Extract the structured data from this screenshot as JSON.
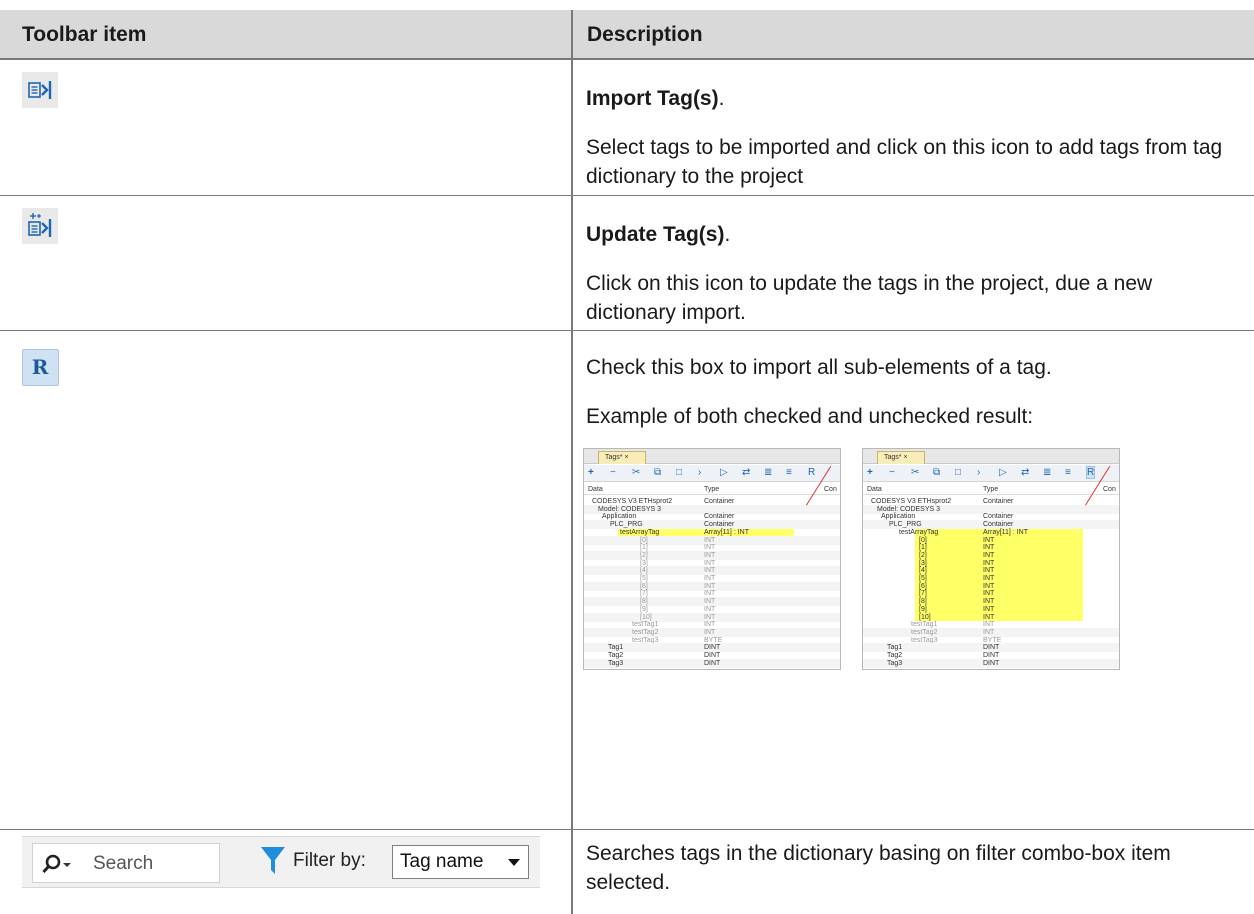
{
  "header": {
    "col1": "Toolbar item",
    "col2": "Description"
  },
  "rows": [
    {
      "icon": "import-tags-icon",
      "title": "Import Tag(s)",
      "title_suffix": ".",
      "desc": "Select tags to be imported and click on this icon to add tags from tag dictionary to the project"
    },
    {
      "icon": "update-tags-icon",
      "title": "Update Tag(s)",
      "title_suffix": ".",
      "desc": "Click on this icon to update the tags in the project, due a new dictionary import."
    },
    {
      "icon": "recursive-import-icon",
      "icon_letter": "R",
      "line1": "Check this box to import all sub-elements of a tag.",
      "line2": "Example of both checked and unchecked result:"
    },
    {
      "icon": "search-icon",
      "search_placeholder": "Search",
      "filter_label": "Filter by:",
      "filter_value": "Tag name",
      "desc": "Searches tags in the dictionary basing on filter combo-box item selected."
    }
  ],
  "screenshot": {
    "tab_label": "Tags*",
    "col_data": "Data",
    "col_type": "Type",
    "col_con": "Con",
    "tree": [
      {
        "name": "CODESYS V3 ETHsprot2",
        "type": "Container"
      },
      {
        "name": "Model: CODESYS 3",
        "type": ""
      },
      {
        "name": "Application",
        "type": "Container"
      },
      {
        "name": "PLC_PRG",
        "type": "Container"
      },
      {
        "name": "testArrayTag",
        "type": "Array[11] : INT"
      },
      {
        "name": "[0]",
        "type": "INT"
      },
      {
        "name": "[1]",
        "type": "INT"
      },
      {
        "name": "[2]",
        "type": "INT"
      },
      {
        "name": "[3]",
        "type": "INT"
      },
      {
        "name": "[4]",
        "type": "INT"
      },
      {
        "name": "[5]",
        "type": "INT"
      },
      {
        "name": "[6]",
        "type": "INT"
      },
      {
        "name": "[7]",
        "type": "INT"
      },
      {
        "name": "[8]",
        "type": "INT"
      },
      {
        "name": "[9]",
        "type": "INT"
      },
      {
        "name": "[10]",
        "type": "INT"
      },
      {
        "name": "testTag1",
        "type": "INT"
      },
      {
        "name": "testTag2",
        "type": "INT"
      },
      {
        "name": "testTag3",
        "type": "BYTE"
      },
      {
        "name": "Tag1",
        "type": "DINT"
      },
      {
        "name": "Tag2",
        "type": "DINT"
      },
      {
        "name": "Tag3",
        "type": "DINT"
      }
    ]
  }
}
